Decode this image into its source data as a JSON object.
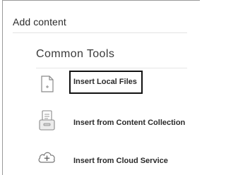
{
  "panel": {
    "title": "Add content"
  },
  "section": {
    "title": "Common Tools",
    "items": [
      {
        "label": "Insert Local Files",
        "icon": "file-icon"
      },
      {
        "label": "Insert from Content Collection",
        "icon": "content-collection-icon"
      },
      {
        "label": "Insert from Cloud Service",
        "icon": "cloud-add-icon"
      }
    ]
  },
  "colors": {
    "focus_border": "#111111",
    "icon_stroke": "#8a8a8a",
    "text": "#2a2a2a"
  }
}
